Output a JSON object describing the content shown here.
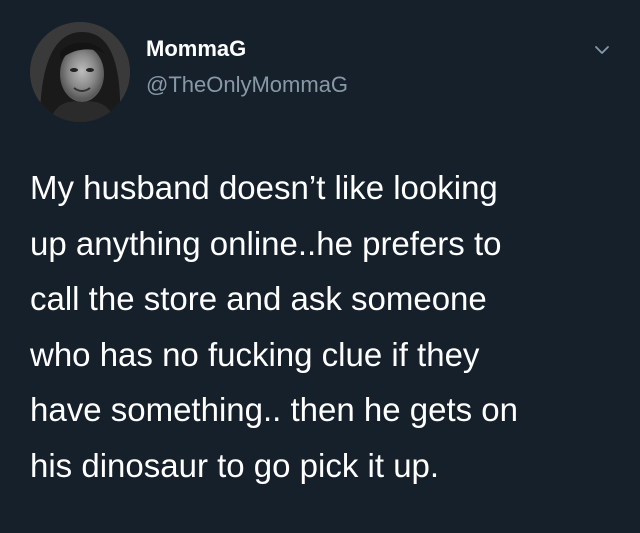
{
  "author": {
    "display_name": "MommaG",
    "handle": "@TheOnlyMommaG",
    "avatar_icon": "profile-photo"
  },
  "menu_icon": "chevron-down-icon",
  "tweet": {
    "lines": [
      "My husband doesn’t like looking",
      "up anything online..he prefers to",
      "call the store and ask someone",
      "who has no fucking clue if they",
      "have something.. then he gets on",
      "his dinosaur to go pick it up."
    ]
  },
  "colors": {
    "background": "#15202b",
    "text": "#ffffff",
    "secondary_text": "#8899a6"
  }
}
